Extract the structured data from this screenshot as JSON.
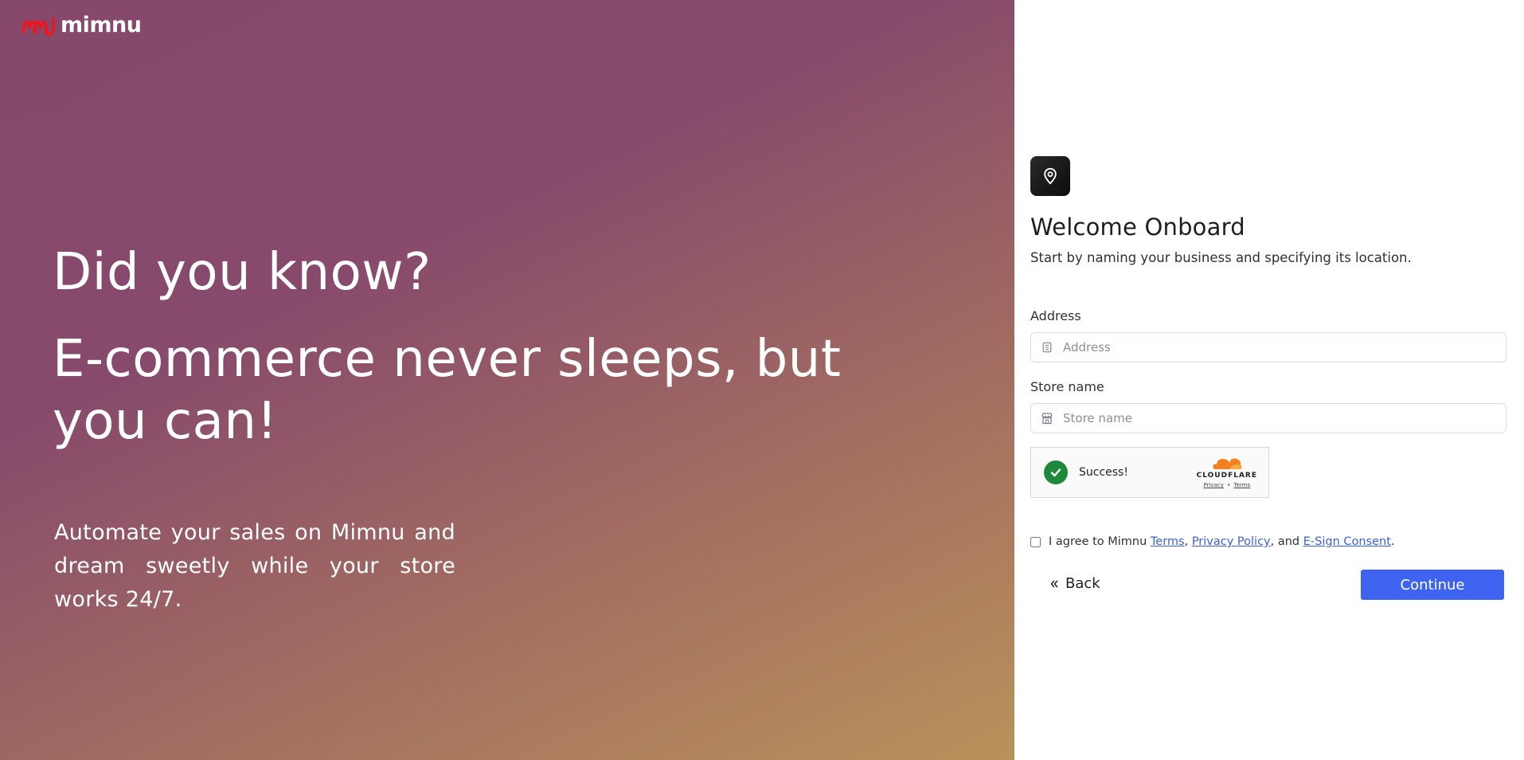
{
  "brand": {
    "name": "mimnu"
  },
  "hero": {
    "question": "Did you know?",
    "headline": "E-commerce never sleeps, but you can!",
    "body": "Automate your sales on Mimnu and dream sweetly while your store works 24/7."
  },
  "form": {
    "title": "Welcome Onboard",
    "subtitle": "Start by naming your business and specifying its location.",
    "address": {
      "label": "Address",
      "placeholder": "Address",
      "value": ""
    },
    "store_name": {
      "label": "Store name",
      "placeholder": "Store name",
      "value": ""
    },
    "captcha": {
      "status": "Success!",
      "provider": "CLOUDFLARE",
      "privacy_label": "Privacy",
      "separator": "•",
      "terms_label": "Terms"
    },
    "agree": {
      "prefix": "I agree to Mimnu ",
      "terms": "Terms",
      "comma": ", ",
      "privacy": "Privacy Policy",
      "and": ", and ",
      "esign": "E-Sign Consent",
      "suffix": "."
    },
    "back_label": "Back",
    "continue_label": "Continue"
  },
  "colors": {
    "accent": "#3e63f0",
    "link": "#3d5fd6",
    "success": "#1d8a3b",
    "logo_red": "#e31b23",
    "gradient_start": "#86496b",
    "gradient_end": "#b9925a"
  },
  "icons": {
    "badge": "location-pin-icon",
    "address": "building-icon",
    "store": "storefront-icon",
    "captcha": "check-circle-icon",
    "back": "double-chevron-left-icon"
  }
}
